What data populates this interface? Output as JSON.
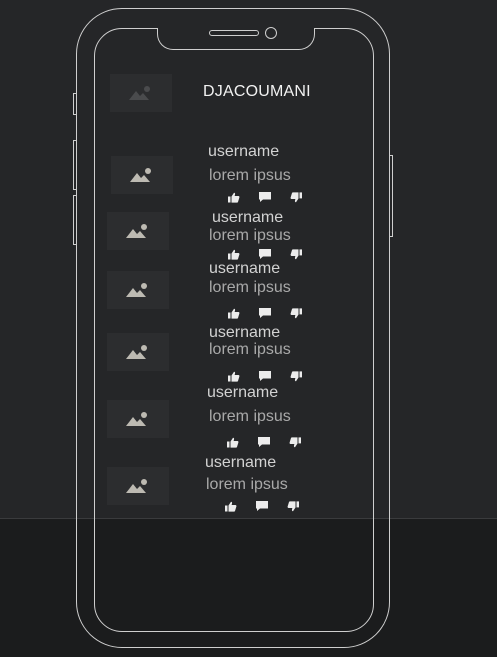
{
  "header": {
    "title": "DJACOUMANI"
  },
  "posts": [
    {
      "username": "username",
      "text": "lorem ipsus"
    },
    {
      "username": "username",
      "text": "lorem ipsus"
    },
    {
      "username": "username",
      "text": "lorem ipsus"
    },
    {
      "username": "username",
      "text": "lorem ipsus"
    },
    {
      "username": "username",
      "text": "lorem ipsus"
    },
    {
      "username": "username",
      "text": "lorem ipsus"
    }
  ],
  "icons": {
    "image_placeholder": "image-icon",
    "like": "thumbs-up-icon",
    "comment": "comment-icon",
    "dislike": "thumbs-down-icon"
  },
  "colors": {
    "background": "#252628",
    "footer": "#1b1c1d",
    "outline": "#cfcfcf"
  }
}
